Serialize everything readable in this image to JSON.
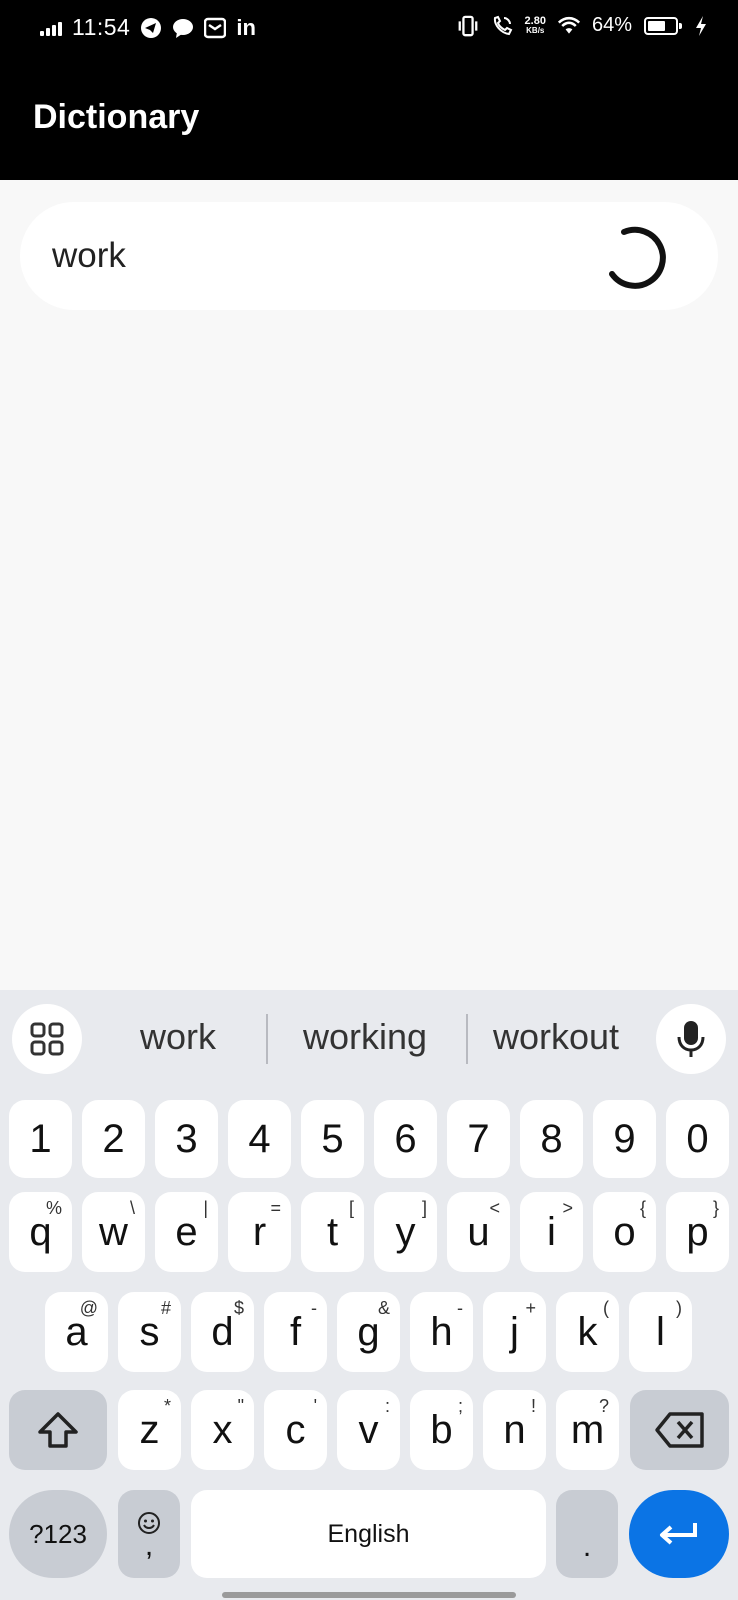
{
  "status_bar": {
    "time": "11:54",
    "net_speed_value": "2.80",
    "net_speed_unit": "KB/s",
    "battery_percent": "64%",
    "battery_level": 0.64,
    "linkedin_label": "in",
    "icons": [
      "signal-icon",
      "telegram-icon",
      "chat-icon",
      "mail-icon",
      "linkedin-icon",
      "vibrate-icon",
      "wifi-call-icon",
      "wifi-icon",
      "battery-icon",
      "charging-icon"
    ]
  },
  "app_bar": {
    "title": "Dictionary"
  },
  "search": {
    "value": "work",
    "loading": true
  },
  "keyboard": {
    "suggestions": [
      "work",
      "working",
      "workout"
    ],
    "number_row": [
      "1",
      "2",
      "3",
      "4",
      "5",
      "6",
      "7",
      "8",
      "9",
      "0"
    ],
    "row1": [
      {
        "key": "q",
        "hint": "%"
      },
      {
        "key": "w",
        "hint": "\\"
      },
      {
        "key": "e",
        "hint": "|"
      },
      {
        "key": "r",
        "hint": "="
      },
      {
        "key": "t",
        "hint": "["
      },
      {
        "key": "y",
        "hint": "]"
      },
      {
        "key": "u",
        "hint": "<"
      },
      {
        "key": "i",
        "hint": ">"
      },
      {
        "key": "o",
        "hint": "{"
      },
      {
        "key": "p",
        "hint": "}"
      }
    ],
    "row2": [
      {
        "key": "a",
        "hint": "@"
      },
      {
        "key": "s",
        "hint": "#"
      },
      {
        "key": "d",
        "hint": "$"
      },
      {
        "key": "f",
        "hint": "-"
      },
      {
        "key": "g",
        "hint": "&"
      },
      {
        "key": "h",
        "hint": "-"
      },
      {
        "key": "j",
        "hint": "+"
      },
      {
        "key": "k",
        "hint": "("
      },
      {
        "key": "l",
        "hint": ")"
      }
    ],
    "row3": [
      {
        "key": "z",
        "hint": "*"
      },
      {
        "key": "x",
        "hint": "\""
      },
      {
        "key": "c",
        "hint": "'"
      },
      {
        "key": "v",
        "hint": ":"
      },
      {
        "key": "b",
        "hint": ";"
      },
      {
        "key": "n",
        "hint": "!"
      },
      {
        "key": "m",
        "hint": "?"
      }
    ],
    "symbols_label": "?123",
    "comma_label": ",",
    "space_label": "English",
    "period_label": ".",
    "accent_color": "#0b74e5"
  }
}
